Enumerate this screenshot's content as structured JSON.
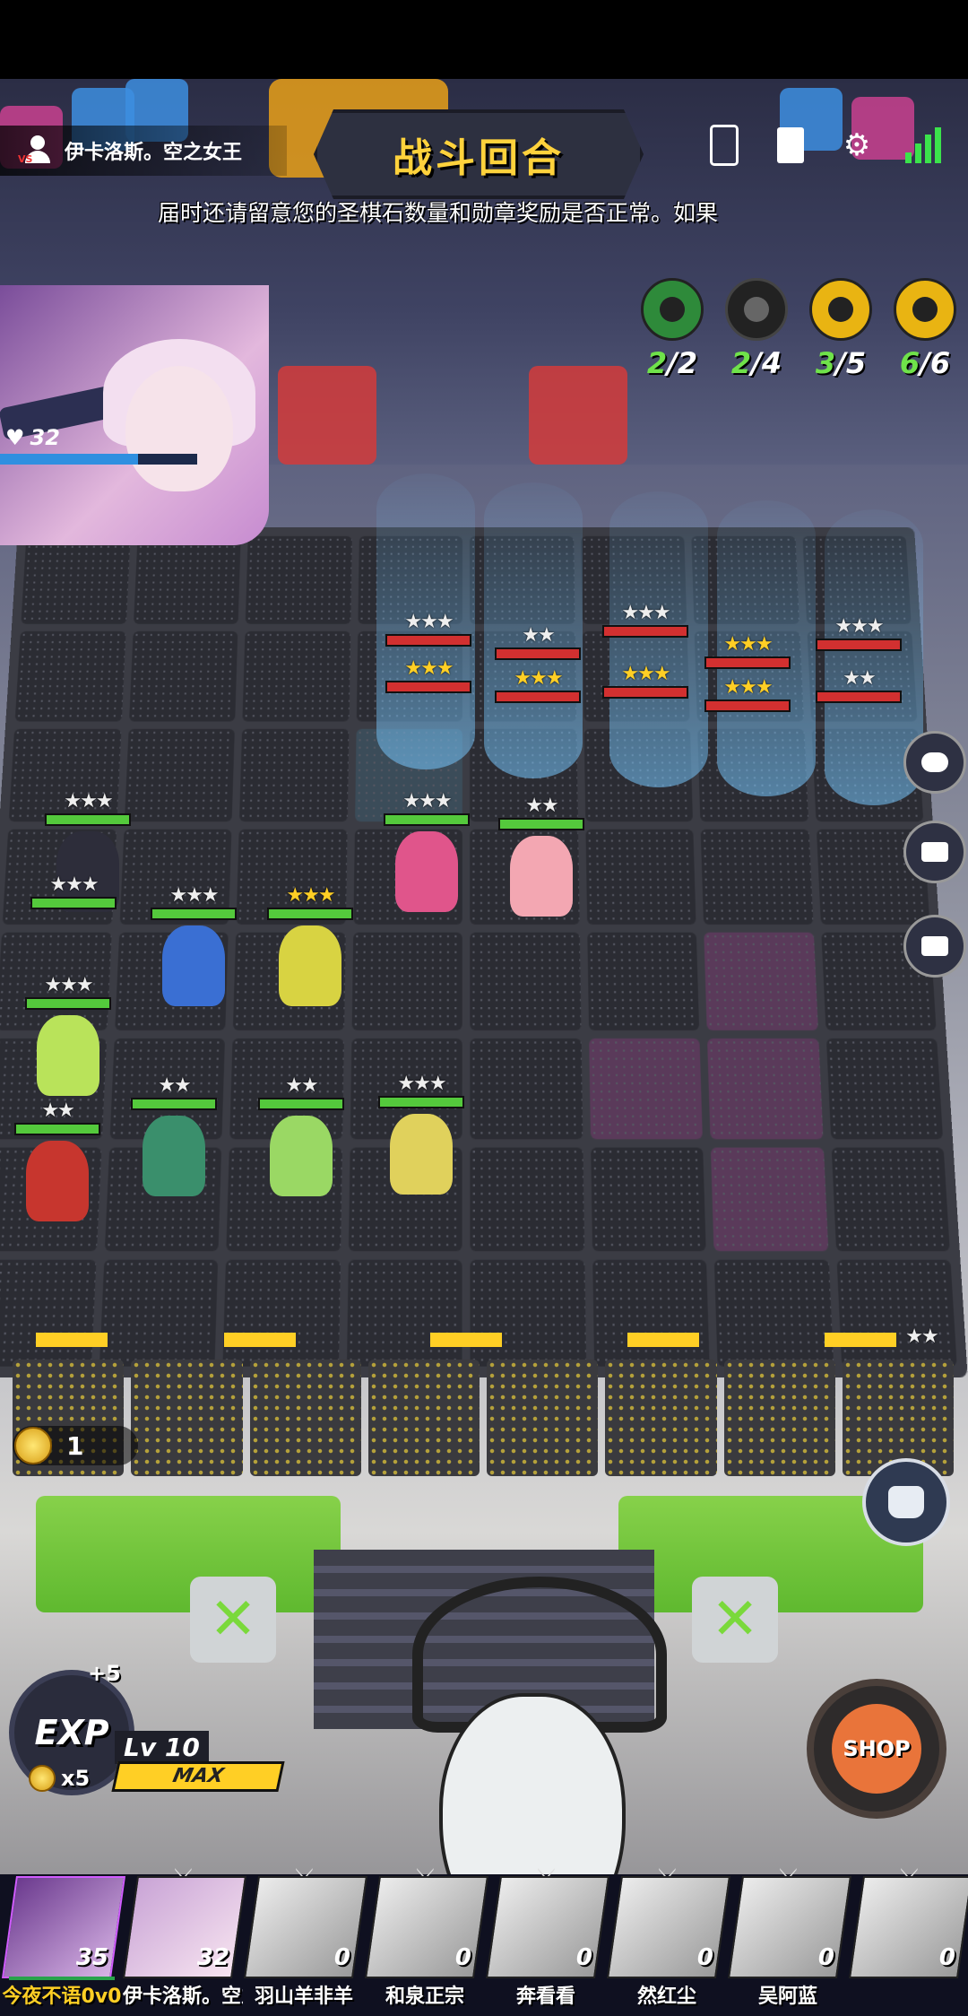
{
  "header": {
    "opponent_name": "伊卡洛斯。空之女王",
    "phase_title": "战斗回合",
    "notice": "届时还请留意您的圣棋石数量和勋章奖励是否正常。如果"
  },
  "top_icons": [
    "phone-swap-icon",
    "book-icon",
    "gear-icon",
    "signal-icon"
  ],
  "player_portrait": {
    "hp": "32"
  },
  "synergies": [
    {
      "icon": "leaf-icon",
      "active": "2",
      "total": "/2",
      "color": "#2e8a3a"
    },
    {
      "icon": "spiral-icon",
      "active": "2",
      "total": "/4",
      "color": "#222"
    },
    {
      "icon": "flame-icon",
      "active": "3",
      "total": "/5",
      "color": "#e9b412"
    },
    {
      "icon": "hood-icon",
      "active": "6",
      "total": "/6",
      "color": "#e9b412"
    }
  ],
  "gold": {
    "amount": "1"
  },
  "exp": {
    "label": "EXP",
    "plus": "+5",
    "cost": "x5"
  },
  "level": {
    "text": "Lv 10",
    "max_label": "MAX"
  },
  "shop": {
    "label": "SHOP"
  },
  "players": [
    {
      "name": "今夜不语0v0",
      "hp": "35",
      "state": "active"
    },
    {
      "name": "伊卡洛斯。空之女王",
      "hp": "32",
      "state": "me"
    },
    {
      "name": "羽山羊非羊",
      "hp": "0",
      "state": "out"
    },
    {
      "name": "和泉正宗",
      "hp": "0",
      "state": "out"
    },
    {
      "name": "奔看看",
      "hp": "0",
      "state": "out"
    },
    {
      "name": "然红尘",
      "hp": "0",
      "state": "out"
    },
    {
      "name": "吴阿蓝",
      "hp": "0",
      "state": "out"
    },
    {
      "name": "",
      "hp": "0",
      "state": "out"
    }
  ]
}
